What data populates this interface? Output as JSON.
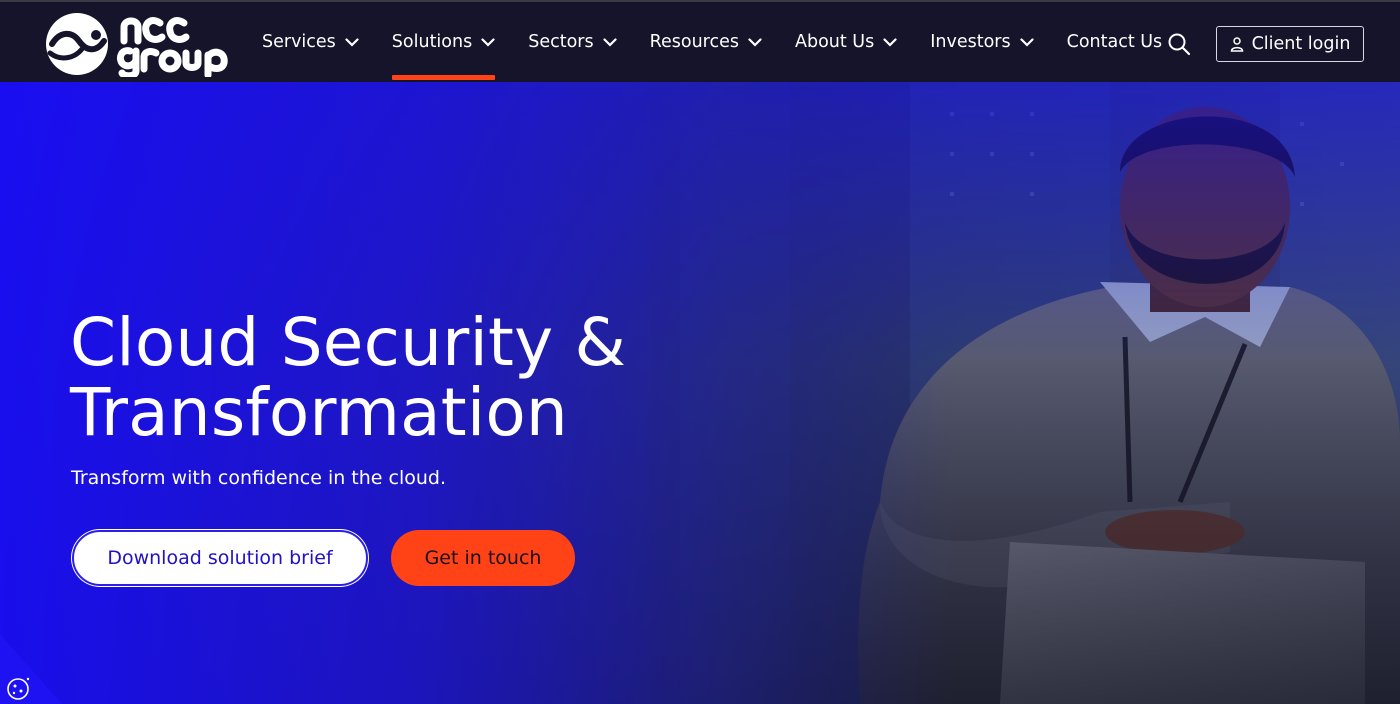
{
  "header": {
    "logo_alt": "ncc group",
    "nav": [
      {
        "label": "Services",
        "has_dropdown": true,
        "active": false
      },
      {
        "label": "Solutions",
        "has_dropdown": true,
        "active": true
      },
      {
        "label": "Sectors",
        "has_dropdown": true,
        "active": false
      },
      {
        "label": "Resources",
        "has_dropdown": true,
        "active": false
      },
      {
        "label": "About Us",
        "has_dropdown": true,
        "active": false
      },
      {
        "label": "Investors",
        "has_dropdown": true,
        "active": false
      },
      {
        "label": "Contact Us",
        "has_dropdown": false,
        "active": false
      }
    ],
    "client_login_label": "Client login"
  },
  "hero": {
    "title_line1": "Cloud Security &",
    "title_line2": "Transformation",
    "subtitle": "Transform with confidence in the cloud.",
    "primary_button": "Download solution brief",
    "secondary_button": "Get in touch"
  },
  "colors": {
    "header_bg": "#15142b",
    "accent_orange": "#ff4316",
    "hero_blue": "#1a0ef5",
    "button_text_blue": "#2110c8"
  },
  "icons": {
    "search": "search-icon",
    "chevron": "chevron-down-icon",
    "user": "user-icon",
    "cookie": "cookie-icon"
  }
}
